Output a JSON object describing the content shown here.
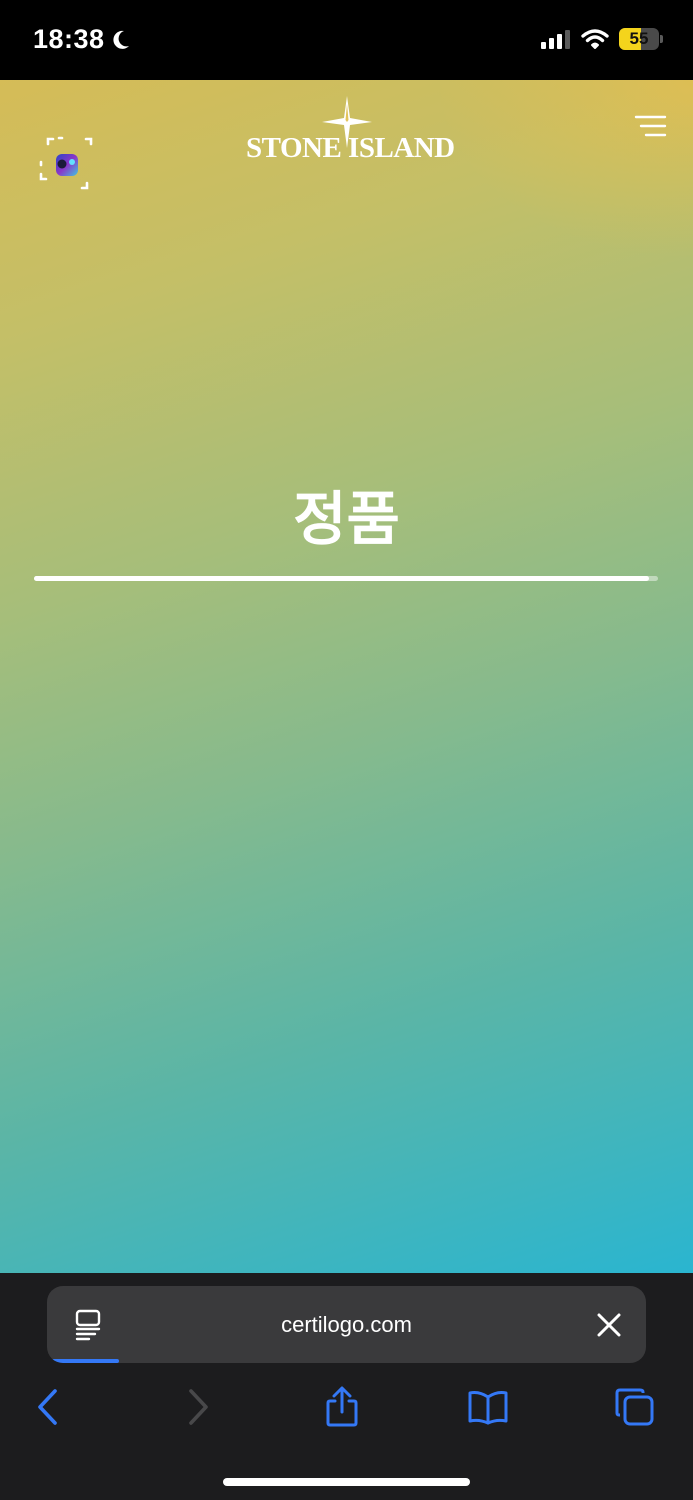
{
  "status_bar": {
    "time": "18:38",
    "battery_level": "55",
    "battery_fraction": 0.55,
    "battery_color": "#f4d41c",
    "icons": [
      "moon-icon",
      "cellular-signal-icon",
      "wifi-icon",
      "battery-icon"
    ]
  },
  "header": {
    "logo_text": "STONE ISLAND",
    "scan_icon": "scan-frame-icon",
    "menu_icon": "menu-icon"
  },
  "main": {
    "heading": "정품",
    "progress": 0.985
  },
  "safari": {
    "url": "certilogo.com",
    "reader_icon": "reader-icon",
    "close_icon": "close-icon",
    "accent_color": "#3478f6",
    "toolbar": [
      "back-icon",
      "forward-icon",
      "share-icon",
      "bookmarks-icon",
      "tabs-icon"
    ]
  }
}
